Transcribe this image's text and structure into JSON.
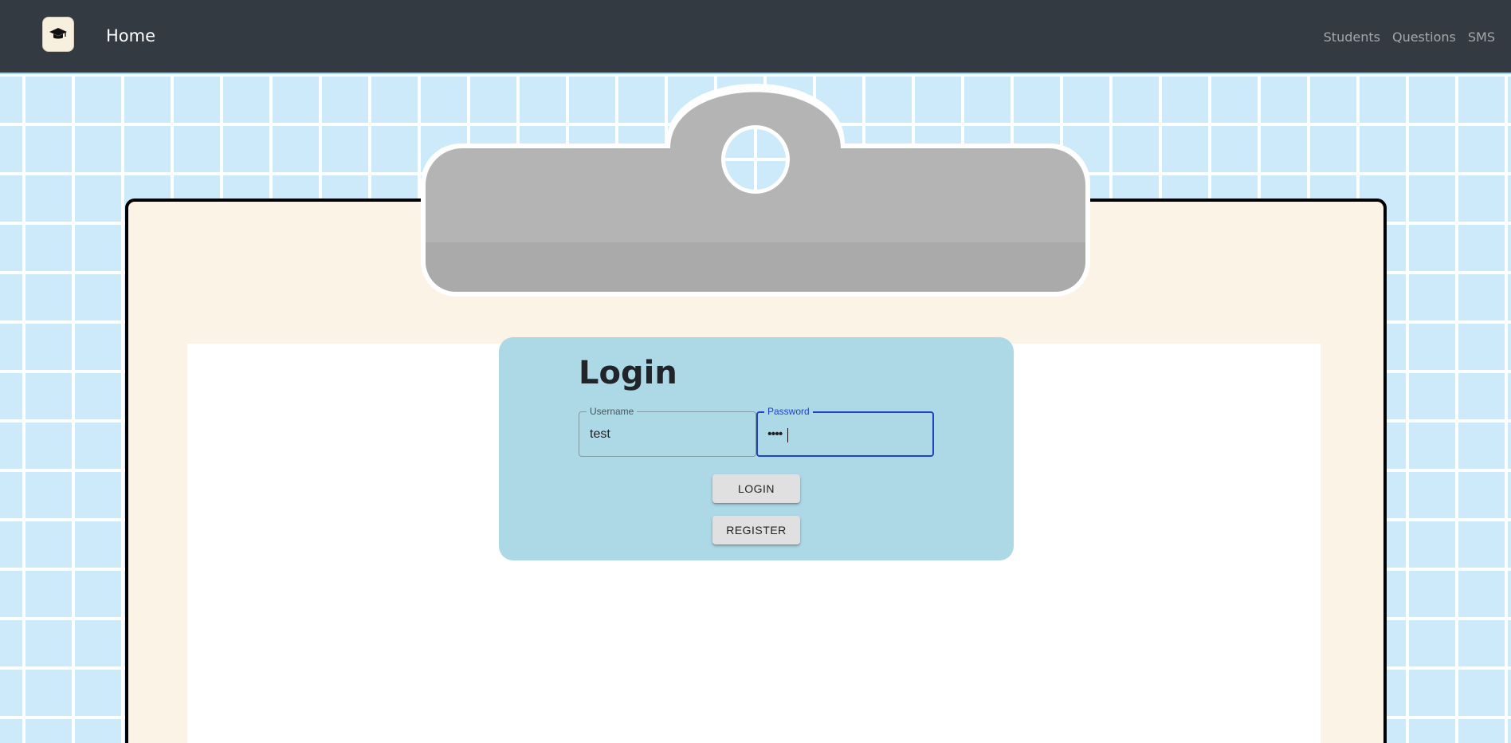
{
  "navbar": {
    "logo_icon": "graduation-cap-icon",
    "brand": "Home",
    "links": [
      {
        "label": "Students"
      },
      {
        "label": "Questions"
      },
      {
        "label": "SMS"
      }
    ]
  },
  "login": {
    "title": "Login",
    "username": {
      "label": "Username",
      "value": "test"
    },
    "password": {
      "label": "Password",
      "value": "••••"
    },
    "login_button": "LOGIN",
    "register_button": "REGISTER"
  },
  "colors": {
    "navbar_bg": "#343a42",
    "page_bg": "#cdeafb",
    "card_bg": "#add8e6",
    "focus_accent": "#1f44c3",
    "board_bg": "#faf3e6",
    "clip_gray": "#b4b4b4"
  }
}
